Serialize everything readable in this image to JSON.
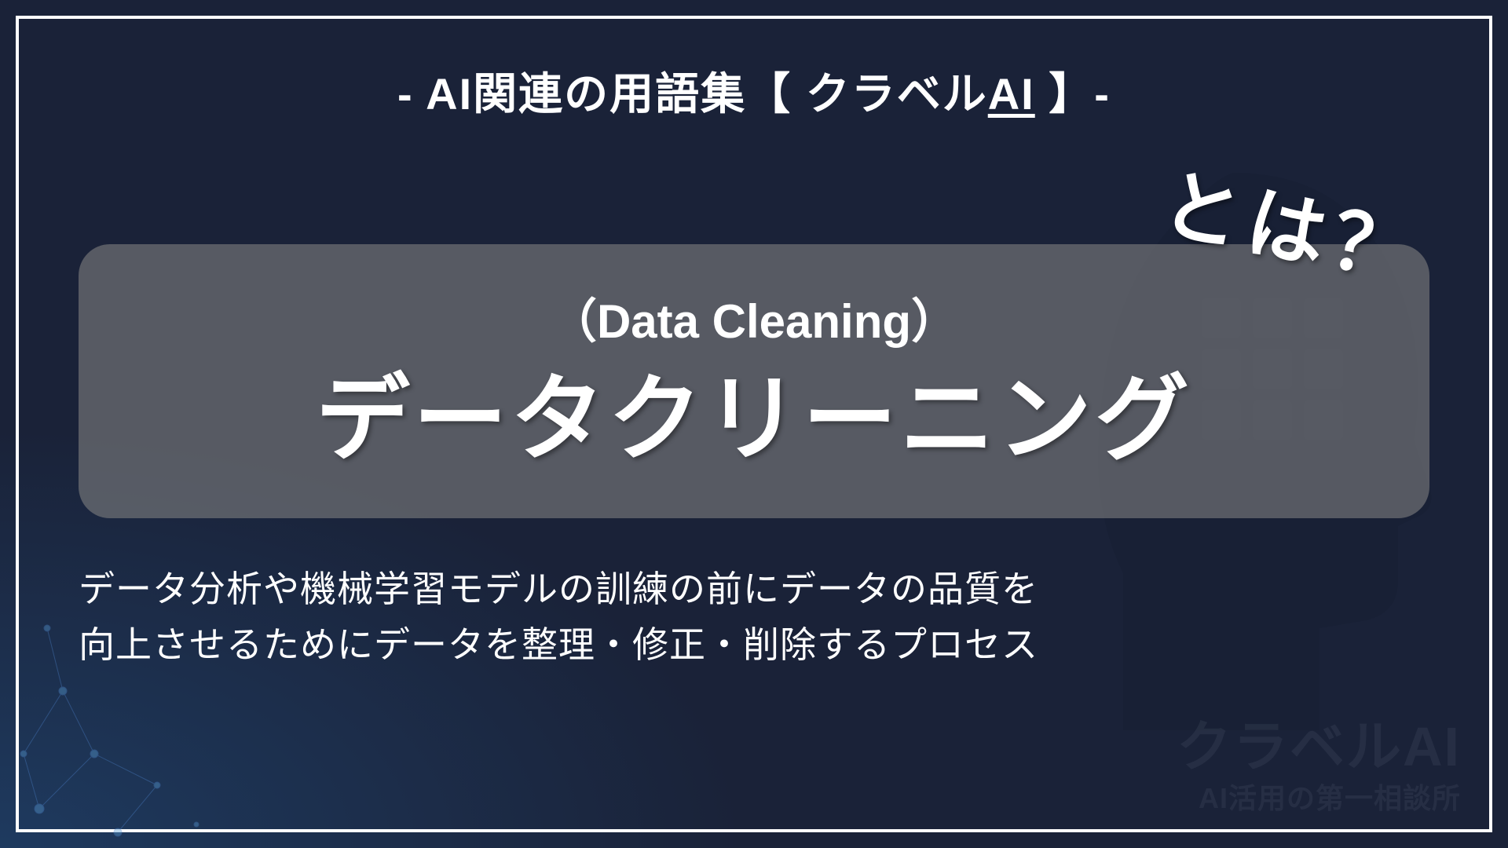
{
  "header": {
    "prefix": "- AI関連の用語集【 クラベル",
    "underlined": "AI",
    "suffix": " 】-"
  },
  "term": {
    "english": "（Data Cleaning）",
    "japanese": "データクリーニング",
    "callout": "とは？"
  },
  "description": {
    "line1": "データ分析や機械学習モデルの訓練の前にデータの品質を",
    "line2": "向上させるためにデータを整理・修正・削除するプロセス"
  },
  "watermark": {
    "main": "クラベルAI",
    "sub": "AI活用の第一相談所"
  }
}
